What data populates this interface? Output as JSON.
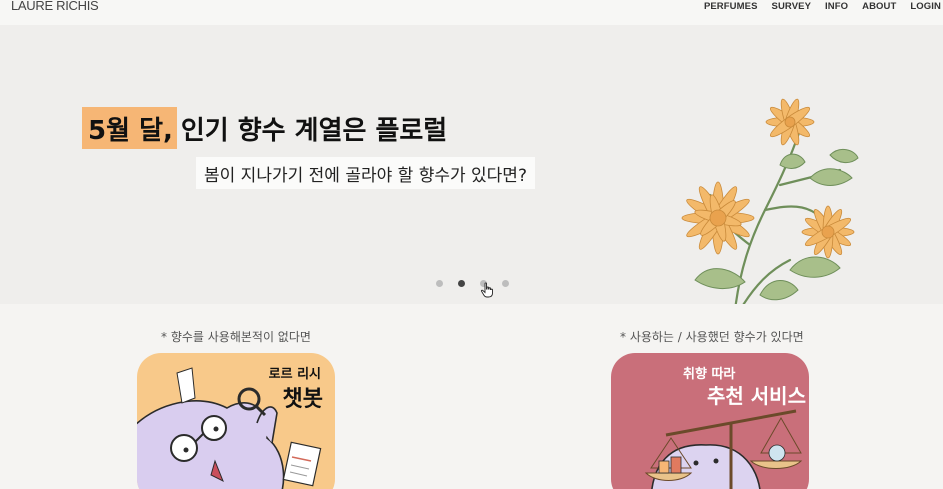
{
  "header": {
    "logo": "LAURE RICHIS",
    "nav": [
      "PERFUMES",
      "SURVEY",
      "INFO",
      "ABOUT",
      "LOGIN"
    ]
  },
  "hero": {
    "title_highlight": "5월 달,",
    "title_rest": "인기 향수 계열은 플로럴",
    "subtitle": "봄이 지나가기 전에 골라야 할 향수가 있다면?",
    "slides_total": 4,
    "active_slide": 2,
    "highlight_color": "#f6b675"
  },
  "services": {
    "left": {
      "caption": "* 향수를 사용해본적이 없다면",
      "card_small": "로르 리시",
      "card_big": "챗봇",
      "bg_color": "#f8c98a"
    },
    "right": {
      "caption": "* 사용하는 / 사용했던 향수가 있다면",
      "card_small": "취향 따라",
      "card_big": "추천 서비스",
      "bg_color": "#c96f7a"
    }
  },
  "icons": {
    "cursor": "hand-pointer-icon",
    "magnifier": "magnifier-icon"
  }
}
